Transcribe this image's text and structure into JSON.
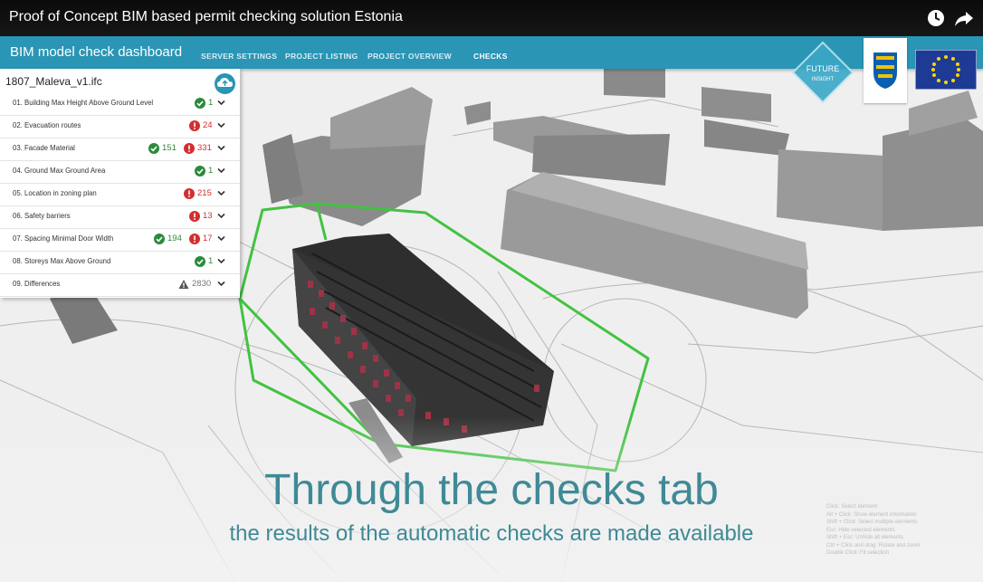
{
  "video": {
    "title": "Proof of Concept BIM based permit checking solution Estonia",
    "icons": [
      "clock-icon",
      "share-icon"
    ]
  },
  "app": {
    "title": "BIM model check dashboard",
    "nav": [
      "SERVER SETTINGS",
      "PROJECT LISTING",
      "PROJECT OVERVIEW",
      "CHECKS"
    ],
    "active_nav": "CHECKS",
    "accent": "#2a95b5"
  },
  "panel": {
    "file_name": "1807_Maleva_v1.ifc",
    "upload_icon": "cloud-upload-icon",
    "checks": [
      {
        "label": "01. Building Max Height Above Ground Level",
        "pass": "1"
      },
      {
        "label": "02. Evacuation routes",
        "fail": "24"
      },
      {
        "label": "03. Facade Material",
        "pass": "151",
        "fail": "331"
      },
      {
        "label": "04. Ground Max Ground Area",
        "pass": "1"
      },
      {
        "label": "05. Location in zoning plan",
        "fail": "215"
      },
      {
        "label": "06. Safety barriers",
        "fail": "13"
      },
      {
        "label": "07. Spacing Minimal Door Width",
        "pass": "194",
        "fail": "17"
      },
      {
        "label": "08. Storeys Max Above Ground",
        "pass": "1"
      },
      {
        "label": "09. Differences",
        "warn": "2830"
      }
    ]
  },
  "logos": {
    "future_insight": "FUTURE INSIGHT"
  },
  "caption": {
    "line1": "Through the checks tab",
    "line2": "the results of the automatic checks are made available"
  },
  "help_text": [
    "Click: Select element",
    "Alt + Click: Show element information",
    "Shift + Click: Select multiple elements",
    "Esc: Hide selected elements",
    "Shift + Esc: Unhide all elements",
    "Ctrl + Click and drag: Rotate and zoom",
    "Double Click: Fit selection"
  ],
  "colors": {
    "pass": "#2c8a3b",
    "fail": "#d32f2f",
    "warn": "#666666",
    "caption": "#3e8a96"
  }
}
